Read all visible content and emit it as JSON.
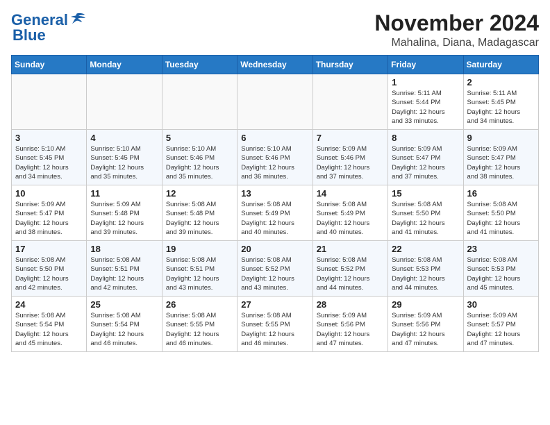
{
  "header": {
    "logo_line1": "General",
    "logo_line2": "Blue",
    "month_title": "November 2024",
    "location": "Mahalina, Diana, Madagascar"
  },
  "days_of_week": [
    "Sunday",
    "Monday",
    "Tuesday",
    "Wednesday",
    "Thursday",
    "Friday",
    "Saturday"
  ],
  "weeks": [
    [
      {
        "day": "",
        "info": ""
      },
      {
        "day": "",
        "info": ""
      },
      {
        "day": "",
        "info": ""
      },
      {
        "day": "",
        "info": ""
      },
      {
        "day": "",
        "info": ""
      },
      {
        "day": "1",
        "info": "Sunrise: 5:11 AM\nSunset: 5:44 PM\nDaylight: 12 hours\nand 33 minutes."
      },
      {
        "day": "2",
        "info": "Sunrise: 5:11 AM\nSunset: 5:45 PM\nDaylight: 12 hours\nand 34 minutes."
      }
    ],
    [
      {
        "day": "3",
        "info": "Sunrise: 5:10 AM\nSunset: 5:45 PM\nDaylight: 12 hours\nand 34 minutes."
      },
      {
        "day": "4",
        "info": "Sunrise: 5:10 AM\nSunset: 5:45 PM\nDaylight: 12 hours\nand 35 minutes."
      },
      {
        "day": "5",
        "info": "Sunrise: 5:10 AM\nSunset: 5:46 PM\nDaylight: 12 hours\nand 35 minutes."
      },
      {
        "day": "6",
        "info": "Sunrise: 5:10 AM\nSunset: 5:46 PM\nDaylight: 12 hours\nand 36 minutes."
      },
      {
        "day": "7",
        "info": "Sunrise: 5:09 AM\nSunset: 5:46 PM\nDaylight: 12 hours\nand 37 minutes."
      },
      {
        "day": "8",
        "info": "Sunrise: 5:09 AM\nSunset: 5:47 PM\nDaylight: 12 hours\nand 37 minutes."
      },
      {
        "day": "9",
        "info": "Sunrise: 5:09 AM\nSunset: 5:47 PM\nDaylight: 12 hours\nand 38 minutes."
      }
    ],
    [
      {
        "day": "10",
        "info": "Sunrise: 5:09 AM\nSunset: 5:47 PM\nDaylight: 12 hours\nand 38 minutes."
      },
      {
        "day": "11",
        "info": "Sunrise: 5:09 AM\nSunset: 5:48 PM\nDaylight: 12 hours\nand 39 minutes."
      },
      {
        "day": "12",
        "info": "Sunrise: 5:08 AM\nSunset: 5:48 PM\nDaylight: 12 hours\nand 39 minutes."
      },
      {
        "day": "13",
        "info": "Sunrise: 5:08 AM\nSunset: 5:49 PM\nDaylight: 12 hours\nand 40 minutes."
      },
      {
        "day": "14",
        "info": "Sunrise: 5:08 AM\nSunset: 5:49 PM\nDaylight: 12 hours\nand 40 minutes."
      },
      {
        "day": "15",
        "info": "Sunrise: 5:08 AM\nSunset: 5:50 PM\nDaylight: 12 hours\nand 41 minutes."
      },
      {
        "day": "16",
        "info": "Sunrise: 5:08 AM\nSunset: 5:50 PM\nDaylight: 12 hours\nand 41 minutes."
      }
    ],
    [
      {
        "day": "17",
        "info": "Sunrise: 5:08 AM\nSunset: 5:50 PM\nDaylight: 12 hours\nand 42 minutes."
      },
      {
        "day": "18",
        "info": "Sunrise: 5:08 AM\nSunset: 5:51 PM\nDaylight: 12 hours\nand 42 minutes."
      },
      {
        "day": "19",
        "info": "Sunrise: 5:08 AM\nSunset: 5:51 PM\nDaylight: 12 hours\nand 43 minutes."
      },
      {
        "day": "20",
        "info": "Sunrise: 5:08 AM\nSunset: 5:52 PM\nDaylight: 12 hours\nand 43 minutes."
      },
      {
        "day": "21",
        "info": "Sunrise: 5:08 AM\nSunset: 5:52 PM\nDaylight: 12 hours\nand 44 minutes."
      },
      {
        "day": "22",
        "info": "Sunrise: 5:08 AM\nSunset: 5:53 PM\nDaylight: 12 hours\nand 44 minutes."
      },
      {
        "day": "23",
        "info": "Sunrise: 5:08 AM\nSunset: 5:53 PM\nDaylight: 12 hours\nand 45 minutes."
      }
    ],
    [
      {
        "day": "24",
        "info": "Sunrise: 5:08 AM\nSunset: 5:54 PM\nDaylight: 12 hours\nand 45 minutes."
      },
      {
        "day": "25",
        "info": "Sunrise: 5:08 AM\nSunset: 5:54 PM\nDaylight: 12 hours\nand 46 minutes."
      },
      {
        "day": "26",
        "info": "Sunrise: 5:08 AM\nSunset: 5:55 PM\nDaylight: 12 hours\nand 46 minutes."
      },
      {
        "day": "27",
        "info": "Sunrise: 5:08 AM\nSunset: 5:55 PM\nDaylight: 12 hours\nand 46 minutes."
      },
      {
        "day": "28",
        "info": "Sunrise: 5:09 AM\nSunset: 5:56 PM\nDaylight: 12 hours\nand 47 minutes."
      },
      {
        "day": "29",
        "info": "Sunrise: 5:09 AM\nSunset: 5:56 PM\nDaylight: 12 hours\nand 47 minutes."
      },
      {
        "day": "30",
        "info": "Sunrise: 5:09 AM\nSunset: 5:57 PM\nDaylight: 12 hours\nand 47 minutes."
      }
    ]
  ]
}
